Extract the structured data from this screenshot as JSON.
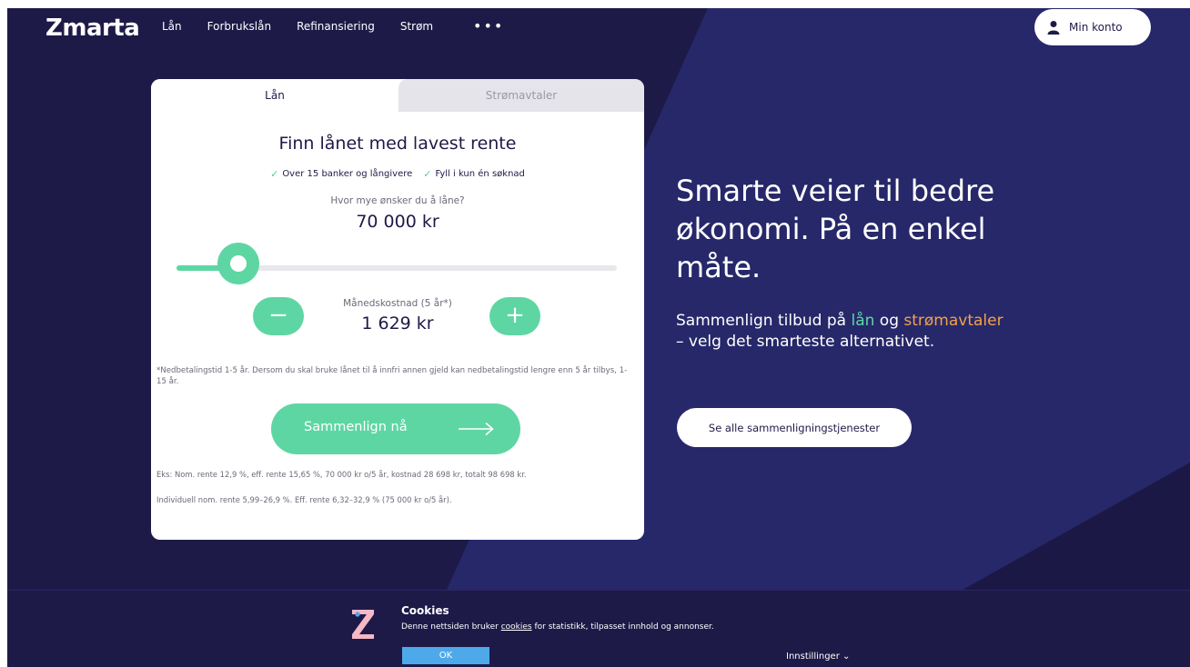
{
  "header": {
    "logo": "Zmarta",
    "nav": [
      "Lån",
      "Forbrukslån",
      "Refinansiering",
      "Strøm"
    ],
    "more_label": "•••",
    "account_label": "Min konto"
  },
  "loan_card": {
    "tabs": [
      {
        "label": "Lån",
        "active": true
      },
      {
        "label": "Strømavtaler",
        "active": false
      }
    ],
    "title": "Finn lånet med lavest rente",
    "usps": [
      "Over 15 banker og långivere",
      "Fyll i kun én søknad"
    ],
    "amount_question": "Hvor mye ønsker du å låne?",
    "amount_value": "70 000 kr",
    "slider_level": 0.14,
    "monthly_label": "Månedskostnad (5 år*)",
    "monthly_value": "1 629 kr",
    "minus_label": "−",
    "plus_label": "+",
    "footnote": "*Nedbetalingstid 1-5 år. Dersom du skal bruke lånet til å innfri annen gjeld kan nedbetalingstid lengre enn 5 år tilbys, 1-15 år.",
    "compare_button": "Sammenlign nå",
    "example_1": "Eks: Nom. rente 12,9 %, eff. rente 15,65 %, 70 000 kr o/5 år, kostnad 28 698 kr, totalt 98 698 kr.",
    "example_2": "Individuell nom. rente 5,99–26,9 %. Eff. rente 6,32–32,9 % (75 000 kr o/5 år)."
  },
  "hero": {
    "title": "Smarte veier til bedre økonomi. På en enkel måte.",
    "sub_prefix": "Sammenlign tilbud på ",
    "sub_loan": "lån",
    "sub_and": " og ",
    "sub_power": "strømavtaler",
    "sub_suffix": " – velg det smarteste alternativet.",
    "all_services_button": "Se alle sammenligningstjenester"
  },
  "cookie_banner": {
    "title": "Cookies",
    "text_prefix": "Denne nettsiden bruker ",
    "text_link": "cookies",
    "text_suffix": " for statistikk, tilpasset innhold og annonser.",
    "ok_button": "OK",
    "settings_label": "Innstillinger ⌄"
  },
  "colors": {
    "background": "#1e1a48",
    "accent_green": "#5ed6a3",
    "accent_orange": "#f2a24a",
    "cookie_ok": "#4da9ea"
  },
  "icons": [
    "user-icon",
    "check-icon",
    "arrow-right-icon",
    "zmarta-z-icon",
    "chevron-down-icon"
  ]
}
